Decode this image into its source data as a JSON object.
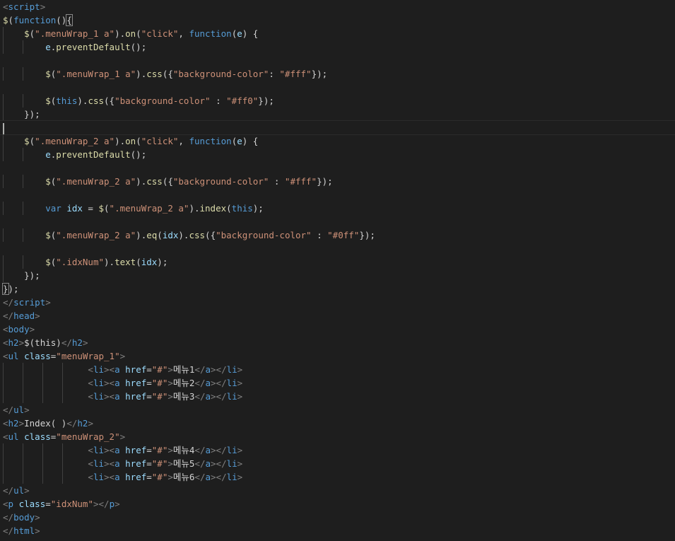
{
  "editor": {
    "language": "html",
    "theme": "dark",
    "colors": {
      "background": "#1e1e1e",
      "tag": "#569cd6",
      "bracket": "#808080",
      "attribute": "#9cdcfe",
      "string": "#ce9178",
      "keyword": "#569cd6",
      "function": "#dcdcaa",
      "variable": "#9cdcfe",
      "text": "#d4d4d4"
    },
    "lines": [
      [
        [
          "br",
          "<"
        ],
        [
          "tag",
          "script"
        ],
        [
          "br",
          ">"
        ]
      ],
      [
        [
          "fn",
          "$"
        ],
        [
          "punc",
          "("
        ],
        [
          "kw",
          "function"
        ],
        [
          "punc",
          "()"
        ],
        [
          "bm",
          "{"
        ]
      ],
      [
        [
          "punc",
          "    "
        ],
        [
          "fn",
          "$"
        ],
        [
          "punc",
          "("
        ],
        [
          "str",
          "\".menuWrap_1 a\""
        ],
        [
          "punc",
          ")."
        ],
        [
          "fn",
          "on"
        ],
        [
          "punc",
          "("
        ],
        [
          "str",
          "\"click\""
        ],
        [
          "punc",
          ", "
        ],
        [
          "kw",
          "function"
        ],
        [
          "punc",
          "("
        ],
        [
          "var",
          "e"
        ],
        [
          "punc",
          ") {"
        ]
      ],
      [
        [
          "punc",
          "        "
        ],
        [
          "var",
          "e"
        ],
        [
          "punc",
          "."
        ],
        [
          "fn",
          "preventDefault"
        ],
        [
          "punc",
          "();"
        ]
      ],
      [],
      [
        [
          "punc",
          "        "
        ],
        [
          "fn",
          "$"
        ],
        [
          "punc",
          "("
        ],
        [
          "str",
          "\".menuWrap_1 a\""
        ],
        [
          "punc",
          ")."
        ],
        [
          "fn",
          "css"
        ],
        [
          "punc",
          "({"
        ],
        [
          "str",
          "\"background-color\""
        ],
        [
          "punc",
          ": "
        ],
        [
          "str",
          "\"#fff\""
        ],
        [
          "punc",
          "});"
        ]
      ],
      [],
      [
        [
          "punc",
          "        "
        ],
        [
          "fn",
          "$"
        ],
        [
          "punc",
          "("
        ],
        [
          "kw",
          "this"
        ],
        [
          "punc",
          ")."
        ],
        [
          "fn",
          "css"
        ],
        [
          "punc",
          "({"
        ],
        [
          "str",
          "\"background-color\""
        ],
        [
          "punc",
          " : "
        ],
        [
          "str",
          "\"#ff0\""
        ],
        [
          "punc",
          "});"
        ]
      ],
      [
        [
          "punc",
          "    });"
        ]
      ],
      [],
      [
        [
          "punc",
          "    "
        ],
        [
          "fn",
          "$"
        ],
        [
          "punc",
          "("
        ],
        [
          "str",
          "\".menuWrap_2 a\""
        ],
        [
          "punc",
          ")."
        ],
        [
          "fn",
          "on"
        ],
        [
          "punc",
          "("
        ],
        [
          "str",
          "\"click\""
        ],
        [
          "punc",
          ", "
        ],
        [
          "kw",
          "function"
        ],
        [
          "punc",
          "("
        ],
        [
          "var",
          "e"
        ],
        [
          "punc",
          ") {"
        ]
      ],
      [
        [
          "punc",
          "        "
        ],
        [
          "var",
          "e"
        ],
        [
          "punc",
          "."
        ],
        [
          "fn",
          "preventDefault"
        ],
        [
          "punc",
          "();"
        ]
      ],
      [],
      [
        [
          "punc",
          "        "
        ],
        [
          "fn",
          "$"
        ],
        [
          "punc",
          "("
        ],
        [
          "str",
          "\".menuWrap_2 a\""
        ],
        [
          "punc",
          ")."
        ],
        [
          "fn",
          "css"
        ],
        [
          "punc",
          "({"
        ],
        [
          "str",
          "\"background-color\""
        ],
        [
          "punc",
          " : "
        ],
        [
          "str",
          "\"#fff\""
        ],
        [
          "punc",
          "});"
        ]
      ],
      [],
      [
        [
          "punc",
          "        "
        ],
        [
          "kw",
          "var"
        ],
        [
          "punc",
          " "
        ],
        [
          "var",
          "idx"
        ],
        [
          "punc",
          " = "
        ],
        [
          "fn",
          "$"
        ],
        [
          "punc",
          "("
        ],
        [
          "str",
          "\".menuWrap_2 a\""
        ],
        [
          "punc",
          ")."
        ],
        [
          "fn",
          "index"
        ],
        [
          "punc",
          "("
        ],
        [
          "kw",
          "this"
        ],
        [
          "punc",
          ");"
        ]
      ],
      [],
      [
        [
          "punc",
          "        "
        ],
        [
          "fn",
          "$"
        ],
        [
          "punc",
          "("
        ],
        [
          "str",
          "\".menuWrap_2 a\""
        ],
        [
          "punc",
          ")."
        ],
        [
          "fn",
          "eq"
        ],
        [
          "punc",
          "("
        ],
        [
          "var",
          "idx"
        ],
        [
          "punc",
          ")."
        ],
        [
          "fn",
          "css"
        ],
        [
          "punc",
          "({"
        ],
        [
          "str",
          "\"background-color\""
        ],
        [
          "punc",
          " : "
        ],
        [
          "str",
          "\"#0ff\""
        ],
        [
          "punc",
          "});"
        ]
      ],
      [],
      [
        [
          "punc",
          "        "
        ],
        [
          "fn",
          "$"
        ],
        [
          "punc",
          "("
        ],
        [
          "str",
          "\".idxNum\""
        ],
        [
          "punc",
          ")."
        ],
        [
          "fn",
          "text"
        ],
        [
          "punc",
          "("
        ],
        [
          "var",
          "idx"
        ],
        [
          "punc",
          ");"
        ]
      ],
      [
        [
          "punc",
          "    });"
        ]
      ],
      [
        [
          "bm",
          "}"
        ],
        [
          "punc",
          ");"
        ]
      ],
      [
        [
          "br",
          "</"
        ],
        [
          "tag",
          "script"
        ],
        [
          "br",
          ">"
        ]
      ],
      [
        [
          "br",
          "</"
        ],
        [
          "tag",
          "head"
        ],
        [
          "br",
          ">"
        ]
      ],
      [
        [
          "br",
          "<"
        ],
        [
          "tag",
          "body"
        ],
        [
          "br",
          ">"
        ]
      ],
      [
        [
          "br",
          "<"
        ],
        [
          "tag",
          "h2"
        ],
        [
          "br",
          ">"
        ],
        [
          "txt",
          "$(this)"
        ],
        [
          "br",
          "</"
        ],
        [
          "tag",
          "h2"
        ],
        [
          "br",
          ">"
        ]
      ],
      [
        [
          "br",
          "<"
        ],
        [
          "tag",
          "ul"
        ],
        [
          "punc",
          " "
        ],
        [
          "attr",
          "class"
        ],
        [
          "punc",
          "="
        ],
        [
          "str",
          "\"menuWrap_1\""
        ],
        [
          "br",
          ">"
        ]
      ],
      [
        [
          "punc",
          "                "
        ],
        [
          "br",
          "<"
        ],
        [
          "tag",
          "li"
        ],
        [
          "br",
          "><"
        ],
        [
          "tag",
          "a"
        ],
        [
          "punc",
          " "
        ],
        [
          "attr",
          "href"
        ],
        [
          "punc",
          "="
        ],
        [
          "str",
          "\"#\""
        ],
        [
          "br",
          ">"
        ],
        [
          "txt",
          "메뉴1"
        ],
        [
          "br",
          "</"
        ],
        [
          "tag",
          "a"
        ],
        [
          "br",
          "></"
        ],
        [
          "tag",
          "li"
        ],
        [
          "br",
          ">"
        ]
      ],
      [
        [
          "punc",
          "                "
        ],
        [
          "br",
          "<"
        ],
        [
          "tag",
          "li"
        ],
        [
          "br",
          "><"
        ],
        [
          "tag",
          "a"
        ],
        [
          "punc",
          " "
        ],
        [
          "attr",
          "href"
        ],
        [
          "punc",
          "="
        ],
        [
          "str",
          "\"#\""
        ],
        [
          "br",
          ">"
        ],
        [
          "txt",
          "메뉴2"
        ],
        [
          "br",
          "</"
        ],
        [
          "tag",
          "a"
        ],
        [
          "br",
          "></"
        ],
        [
          "tag",
          "li"
        ],
        [
          "br",
          ">"
        ]
      ],
      [
        [
          "punc",
          "                "
        ],
        [
          "br",
          "<"
        ],
        [
          "tag",
          "li"
        ],
        [
          "br",
          "><"
        ],
        [
          "tag",
          "a"
        ],
        [
          "punc",
          " "
        ],
        [
          "attr",
          "href"
        ],
        [
          "punc",
          "="
        ],
        [
          "str",
          "\"#\""
        ],
        [
          "br",
          ">"
        ],
        [
          "txt",
          "메뉴3"
        ],
        [
          "br",
          "</"
        ],
        [
          "tag",
          "a"
        ],
        [
          "br",
          "></"
        ],
        [
          "tag",
          "li"
        ],
        [
          "br",
          ">"
        ]
      ],
      [
        [
          "br",
          "</"
        ],
        [
          "tag",
          "ul"
        ],
        [
          "br",
          ">"
        ]
      ],
      [
        [
          "br",
          "<"
        ],
        [
          "tag",
          "h2"
        ],
        [
          "br",
          ">"
        ],
        [
          "txt",
          "Index( )"
        ],
        [
          "br",
          "</"
        ],
        [
          "tag",
          "h2"
        ],
        [
          "br",
          ">"
        ]
      ],
      [
        [
          "br",
          "<"
        ],
        [
          "tag",
          "ul"
        ],
        [
          "punc",
          " "
        ],
        [
          "attr",
          "class"
        ],
        [
          "punc",
          "="
        ],
        [
          "str",
          "\"menuWrap_2\""
        ],
        [
          "br",
          ">"
        ]
      ],
      [
        [
          "punc",
          "                "
        ],
        [
          "br",
          "<"
        ],
        [
          "tag",
          "li"
        ],
        [
          "br",
          "><"
        ],
        [
          "tag",
          "a"
        ],
        [
          "punc",
          " "
        ],
        [
          "attr",
          "href"
        ],
        [
          "punc",
          "="
        ],
        [
          "str",
          "\"#\""
        ],
        [
          "br",
          ">"
        ],
        [
          "txt",
          "메뉴4"
        ],
        [
          "br",
          "</"
        ],
        [
          "tag",
          "a"
        ],
        [
          "br",
          "></"
        ],
        [
          "tag",
          "li"
        ],
        [
          "br",
          ">"
        ]
      ],
      [
        [
          "punc",
          "                "
        ],
        [
          "br",
          "<"
        ],
        [
          "tag",
          "li"
        ],
        [
          "br",
          "><"
        ],
        [
          "tag",
          "a"
        ],
        [
          "punc",
          " "
        ],
        [
          "attr",
          "href"
        ],
        [
          "punc",
          "="
        ],
        [
          "str",
          "\"#\""
        ],
        [
          "br",
          ">"
        ],
        [
          "txt",
          "메뉴5"
        ],
        [
          "br",
          "</"
        ],
        [
          "tag",
          "a"
        ],
        [
          "br",
          "></"
        ],
        [
          "tag",
          "li"
        ],
        [
          "br",
          ">"
        ]
      ],
      [
        [
          "punc",
          "                "
        ],
        [
          "br",
          "<"
        ],
        [
          "tag",
          "li"
        ],
        [
          "br",
          "><"
        ],
        [
          "tag",
          "a"
        ],
        [
          "punc",
          " "
        ],
        [
          "attr",
          "href"
        ],
        [
          "punc",
          "="
        ],
        [
          "str",
          "\"#\""
        ],
        [
          "br",
          ">"
        ],
        [
          "txt",
          "메뉴6"
        ],
        [
          "br",
          "</"
        ],
        [
          "tag",
          "a"
        ],
        [
          "br",
          "></"
        ],
        [
          "tag",
          "li"
        ],
        [
          "br",
          ">"
        ]
      ],
      [
        [
          "br",
          "</"
        ],
        [
          "tag",
          "ul"
        ],
        [
          "br",
          ">"
        ]
      ],
      [
        [
          "br",
          "<"
        ],
        [
          "tag",
          "p"
        ],
        [
          "punc",
          " "
        ],
        [
          "attr",
          "class"
        ],
        [
          "punc",
          "="
        ],
        [
          "str",
          "\"idxNum\""
        ],
        [
          "br",
          "></"
        ],
        [
          "tag",
          "p"
        ],
        [
          "br",
          ">"
        ]
      ],
      [
        [
          "br",
          "</"
        ],
        [
          "tag",
          "body"
        ],
        [
          "br",
          ">"
        ]
      ],
      [
        [
          "br",
          "</"
        ],
        [
          "tag",
          "html"
        ],
        [
          "br",
          ">"
        ]
      ]
    ]
  }
}
